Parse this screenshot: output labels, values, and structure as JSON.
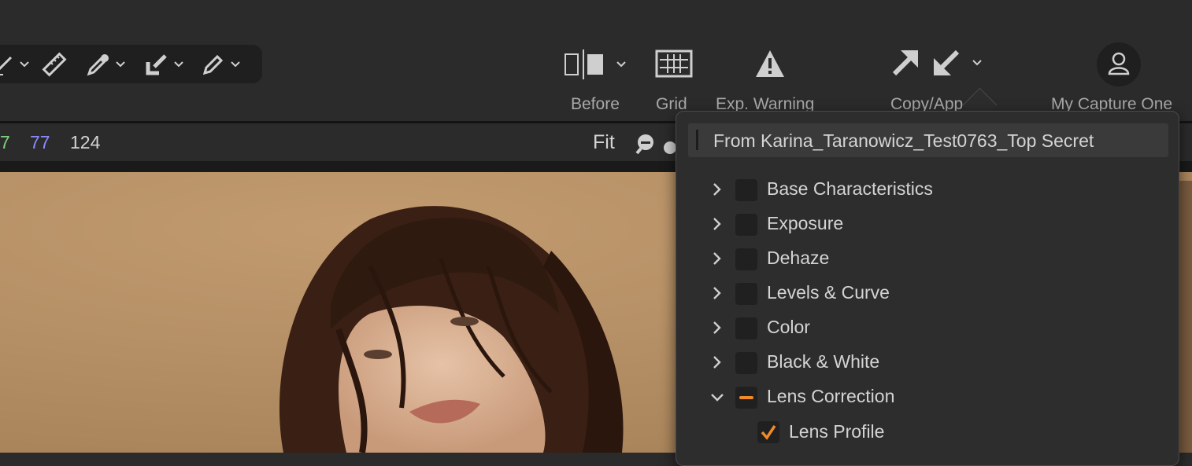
{
  "toolbar": {
    "buttons": [
      {
        "label": "Before",
        "icon": "before-after-icon"
      },
      {
        "label": "Grid",
        "icon": "grid-icon"
      },
      {
        "label": "Exp. Warning",
        "icon": "exposure-warning-icon"
      },
      {
        "label": "Copy/App",
        "icon": "copy-apply-icon"
      },
      {
        "label": "My Capture One",
        "icon": "user-icon"
      }
    ]
  },
  "infobar": {
    "g_value": "7",
    "b_value": "77",
    "l_value": "124",
    "zoom": "Fit"
  },
  "copy_panel": {
    "source": "From Karina_Taranowicz_Test0763_Top Secret",
    "items": [
      {
        "label": "Base Characteristics",
        "state": "unchecked",
        "expanded": false
      },
      {
        "label": "Exposure",
        "state": "unchecked",
        "expanded": false
      },
      {
        "label": "Dehaze",
        "state": "unchecked",
        "expanded": false
      },
      {
        "label": "Levels & Curve",
        "state": "unchecked",
        "expanded": false
      },
      {
        "label": "Color",
        "state": "unchecked",
        "expanded": false
      },
      {
        "label": "Black & White",
        "state": "unchecked",
        "expanded": false
      },
      {
        "label": "Lens Correction",
        "state": "partial",
        "expanded": true
      }
    ],
    "subitems": [
      {
        "label": "Lens Profile",
        "state": "checked"
      }
    ]
  },
  "colors": {
    "accent": "#f08a2a",
    "g_text": "#7fd17f",
    "b_text": "#8a8aff"
  }
}
